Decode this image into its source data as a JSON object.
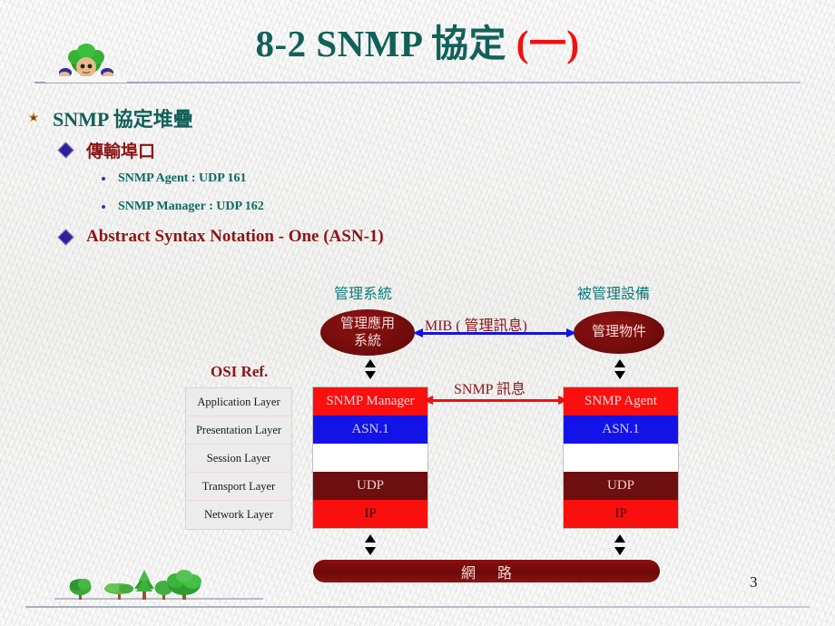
{
  "slide": {
    "title_main": "8-2 SNMP 協定 ",
    "title_sub": "(一)",
    "page_number": "3"
  },
  "bullets": {
    "level1": {
      "label": "SNMP 協定堆疊",
      "marker": "star-bullet-icon"
    },
    "level2a": {
      "label": "傳輸埠口",
      "marker": "diamond-bullet-icon"
    },
    "level3": [
      {
        "label": "SNMP Agent : UDP 161",
        "marker": "dot-bullet-icon"
      },
      {
        "label": "SNMP Manager : UDP 162",
        "marker": "dot-bullet-icon"
      }
    ],
    "level2b": {
      "label": "Abstract Syntax Notation - One (ASN-1)",
      "marker": "diamond-bullet-icon"
    }
  },
  "diagram": {
    "column_headers": {
      "left": "管理系統",
      "right": "被管理設備"
    },
    "ellipses": {
      "left_line1": "管理應用",
      "left_line2": "系統",
      "right": "管理物件"
    },
    "osi_ref_label": "OSI Ref.",
    "osi_layers": [
      "Application Layer",
      "Presentation Layer",
      "Session Layer",
      "Transport Layer",
      "Network Layer"
    ],
    "manager_stack": [
      "SNMP Manager",
      "ASN.1",
      "",
      "UDP",
      "IP"
    ],
    "agent_stack": [
      "SNMP Agent",
      "ASN.1",
      "",
      "UDP",
      "IP"
    ],
    "arrows": {
      "mib_label": "MIB ( 管理訊息)",
      "snmp_label": "SNMP 訊息",
      "mib_color": "#1414e0",
      "snmp_color": "#f01010"
    },
    "network_bar": "網 路"
  },
  "colors": {
    "title_teal": "#116159",
    "title_red": "#ef1111",
    "heading_teal": "#116159",
    "subheading_dark_red": "#8c1414",
    "header_teal": "#0d7b78",
    "ellipse_dark_red": "#7a0e0e",
    "layer_red": "#fa0f0f",
    "layer_blue": "#1313e8",
    "layer_dark_red": "#6e0f0f"
  }
}
